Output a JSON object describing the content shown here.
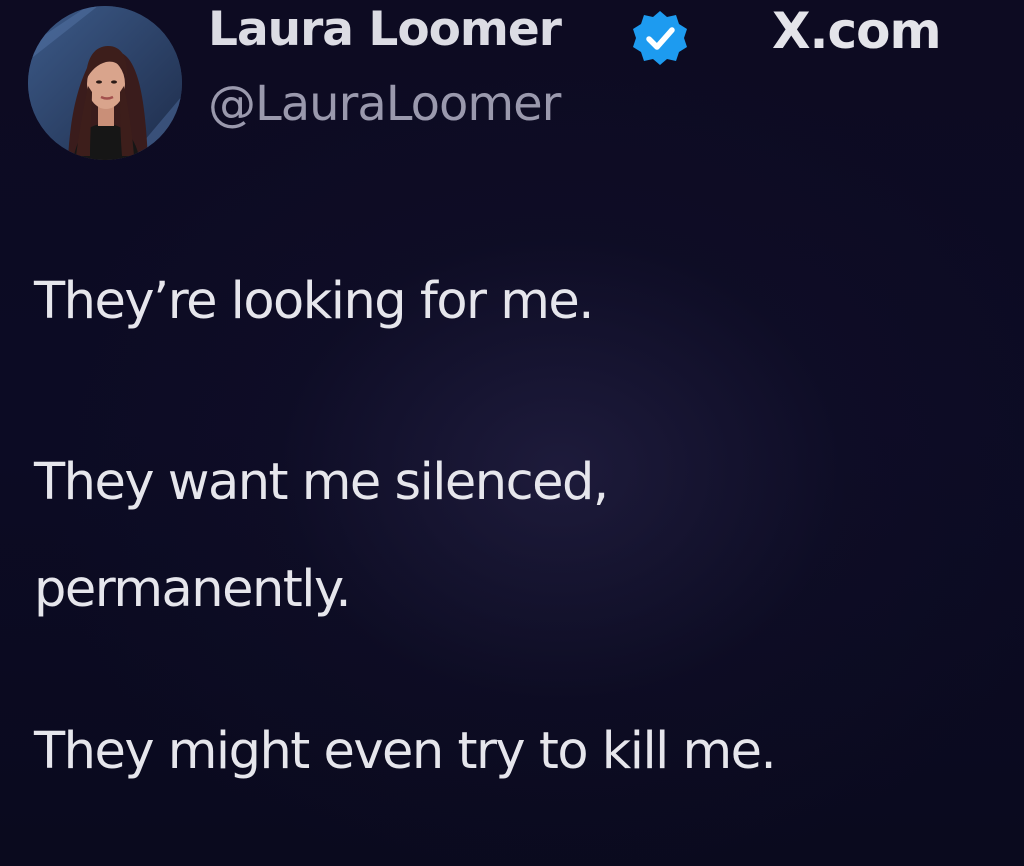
{
  "tweet": {
    "author": {
      "display_name": "Laura Loomer",
      "handle": "@LauraLoomer",
      "verified": true,
      "avatar_icon": "profile-photo"
    },
    "site_label": "X.com",
    "body_lines": [
      "They’re looking for me.",
      "They want me silenced,",
      "permanently.",
      "They might even try to kill me."
    ]
  },
  "colors": {
    "background": "#0c0b24",
    "text": "#e6e6ec",
    "handle": "#9a99ad",
    "verified_badge": "#1d9bf0"
  }
}
